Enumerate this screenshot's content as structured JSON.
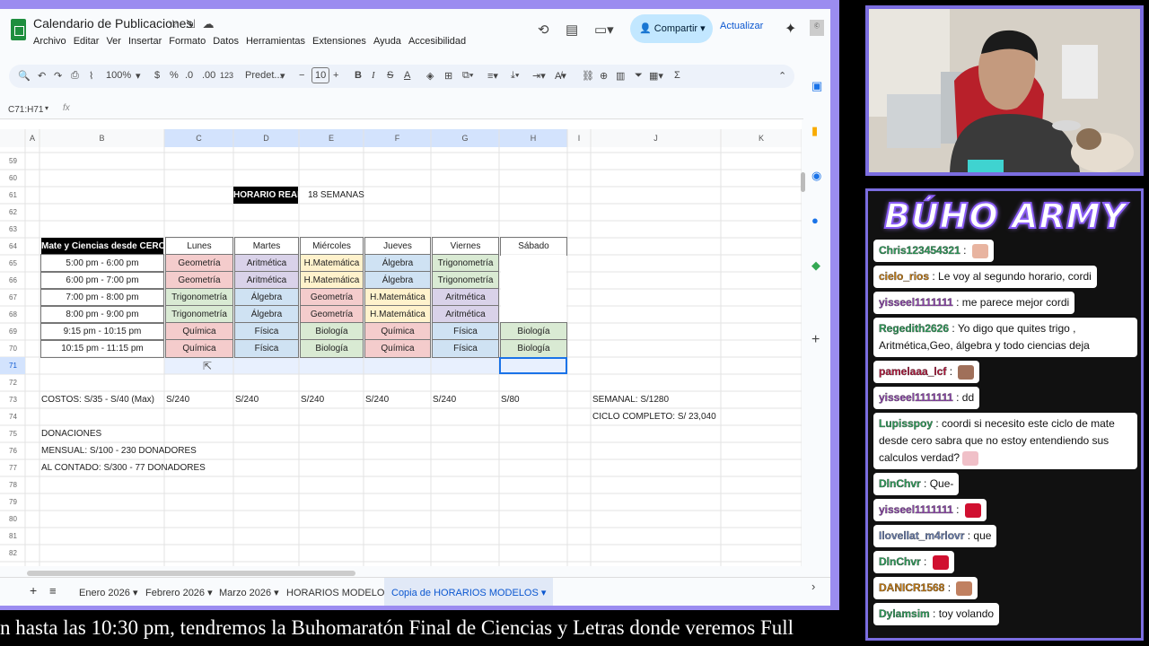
{
  "sheets": {
    "title": "Calendario de Publicaciones",
    "menu": [
      "Archivo",
      "Editar",
      "Ver",
      "Insertar",
      "Formato",
      "Datos",
      "Herramientas",
      "Extensiones",
      "Ayuda",
      "Accesibilidad"
    ],
    "share_label": "Compartir",
    "update_label": "Actualizar",
    "toolbar": {
      "zoom": "100%",
      "currency": "$",
      "percent": "%",
      "dec_minus": ".0",
      "dec_plus": ".00",
      "fmt123": "123",
      "font": "Predet...",
      "font_size": "10"
    },
    "name_box": "C71:H71",
    "fx": "fx",
    "columns": [
      "A",
      "B",
      "C",
      "D",
      "E",
      "F",
      "G",
      "H",
      "I",
      "J",
      "K"
    ],
    "rows": [
      "59",
      "60",
      "61",
      "62",
      "63",
      "64",
      "65",
      "66",
      "67",
      "68",
      "69",
      "70",
      "71",
      "72",
      "73",
      "74",
      "75",
      "76",
      "77",
      "78",
      "79",
      "80",
      "81",
      "82"
    ],
    "horario_real": "HORARIO REAL",
    "semanas": "18 SEMANAS",
    "table_header": "Mate y Ciencias desde CERO",
    "days": [
      "Lunes",
      "Martes",
      "Miércoles",
      "Jueves",
      "Viernes",
      "Sábado"
    ],
    "schedule": [
      {
        "time": "5:00 pm - 6:00 pm",
        "cells": [
          "Geometría",
          "Aritmética",
          "H.Matemática",
          "Álgebra",
          "Trigonometría",
          ""
        ]
      },
      {
        "time": "6:00 pm - 7:00 pm",
        "cells": [
          "Geometría",
          "Aritmética",
          "H.Matemática",
          "Álgebra",
          "Trigonometría",
          ""
        ]
      },
      {
        "time": "7:00 pm - 8:00 pm",
        "cells": [
          "Trigonometría",
          "Álgebra",
          "Geometría",
          "H.Matemática",
          "Aritmética",
          ""
        ]
      },
      {
        "time": "8:00 pm - 9:00 pm",
        "cells": [
          "Trigonometría",
          "Álgebra",
          "Geometría",
          "H.Matemática",
          "Aritmética",
          ""
        ]
      },
      {
        "time": "9:15 pm - 10:15 pm",
        "cells": [
          "Química",
          "Física",
          "Biología",
          "Química",
          "Física",
          "Biología"
        ]
      },
      {
        "time": "10:15 pm - 11:15 pm",
        "cells": [
          "Química",
          "Física",
          "Biología",
          "Química",
          "Física",
          "Biología"
        ]
      }
    ],
    "subject_colors": {
      "Geometría": "#f4cccc",
      "Aritmética": "#d9d2e9",
      "H.Matemática": "#fff2cc",
      "Álgebra": "#cfe2f3",
      "Trigonometría": "#d9ead3",
      "Química": "#f4cccc",
      "Física": "#cfe2f3",
      "Biología": "#d9ead3"
    },
    "costos_label": "COSTOS: S/35 - S/40 (Max)",
    "costos": [
      "S/240",
      "S/240",
      "S/240",
      "S/240",
      "S/240",
      "S/80"
    ],
    "semanal": "SEMANAL: S/1280",
    "ciclo": "CICLO COMPLETO: S/ 23,040",
    "donaciones": "DONACIONES",
    "mensual": "MENSUAL: S/100 -  230 DONADORES",
    "contado": "AL CONTADO: S/300 -  77 DONADORES",
    "tabs": [
      "Enero 2026",
      "Febrero 2026",
      "Marzo 2026",
      "HORARIOS MODELOS",
      "Copia de HORARIOS MODELOS"
    ]
  },
  "chat": {
    "title": "BÚHO ARMY",
    "messages": [
      {
        "user": "Chris123454321",
        "color": "#2e9e5b",
        "text": "",
        "emote": "#e8b4a0"
      },
      {
        "user": "cielo_rios",
        "color": "#c47a12",
        "text": "Le voy al segundo horario, cordi",
        "emote": ""
      },
      {
        "user": "yisseel1111111",
        "color": "#8e44ad",
        "text": "me parece mejor cordi",
        "emote": ""
      },
      {
        "user": "Regedith2626",
        "color": "#2e9e5b",
        "text": "Yo digo que quites trigo , Aritmética,Geo, álgebra y todo ciencias deja",
        "emote": ""
      },
      {
        "user": "pamelaaa_lcf",
        "color": "#b5163c",
        "text": "",
        "emote": "#a0705a"
      },
      {
        "user": "yisseel1111111",
        "color": "#8e44ad",
        "text": "dd",
        "emote": ""
      },
      {
        "user": "Lupisspoy",
        "color": "#2e9e5b",
        "text": "coordi si necesito este ciclo de mate desde cero sabra que no estoy entendiendo sus calculos verdad?",
        "emote": "#f0c0c8"
      },
      {
        "user": "DlnChvr",
        "color": "#2e9e5b",
        "text": "Que-",
        "emote": ""
      },
      {
        "user": "yisseel1111111",
        "color": "#8e44ad",
        "text": "",
        "emote": "#d01030"
      },
      {
        "user": "Ilovellat_m4rlovr",
        "color": "#6a7fb0",
        "text": "que",
        "emote": ""
      },
      {
        "user": "DlnChvr",
        "color": "#2e9e5b",
        "text": "",
        "emote": "#d01030"
      },
      {
        "user": "DANICR1568",
        "color": "#c47a12",
        "text": "",
        "emote": "#c08060"
      },
      {
        "user": "Dylamsim",
        "color": "#2e9e5b",
        "text": "toy volando",
        "emote": ""
      }
    ]
  },
  "ticker": "n hasta las 10:30 pm, tendremos la Buhomaratón Final de Ciencias y Letras donde veremos Full"
}
